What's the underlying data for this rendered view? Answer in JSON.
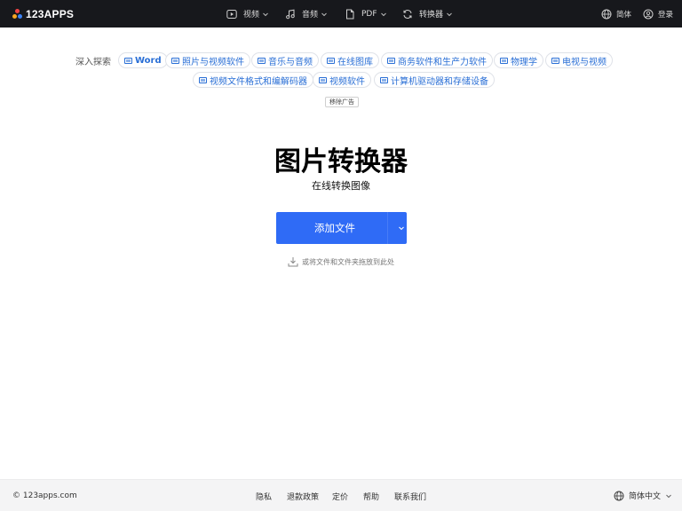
{
  "header": {
    "logo_text": "123APPS",
    "logo_colors": [
      "#f5a623",
      "#3b82f6",
      "#ef4444"
    ],
    "nav": [
      {
        "label": "视频",
        "icon": "play-icon"
      },
      {
        "label": "音频",
        "icon": "music-note-icon"
      },
      {
        "label": "PDF",
        "icon": "document-icon"
      },
      {
        "label": "转换器",
        "icon": "convert-icon"
      }
    ],
    "language_label": "简体",
    "login_label": "登录"
  },
  "explore": {
    "label": "深入探索",
    "chips": [
      "Word",
      "照片与视频软件",
      "音乐与音频",
      "在线图库",
      "商务软件和生产力软件",
      "物理学",
      "电视与视频",
      "视频文件格式和编解码器",
      "视频软件",
      "计算机驱动器和存储设备"
    ],
    "remove_ad": "移除广告"
  },
  "hero": {
    "title": "图片转换器",
    "subtitle": "在线转换图像",
    "add_button": "添加文件",
    "drop_hint": "或将文件和文件夹拖放到此处"
  },
  "footer": {
    "copyright": "© 123apps.com",
    "links": [
      "隐私",
      "退款政策",
      "定价",
      "帮助",
      "联系我们"
    ],
    "language": "简体中文"
  },
  "colors": {
    "accent": "#2f6bf6",
    "header_bg": "#17181c",
    "chip_text": "#2a6fd6"
  }
}
